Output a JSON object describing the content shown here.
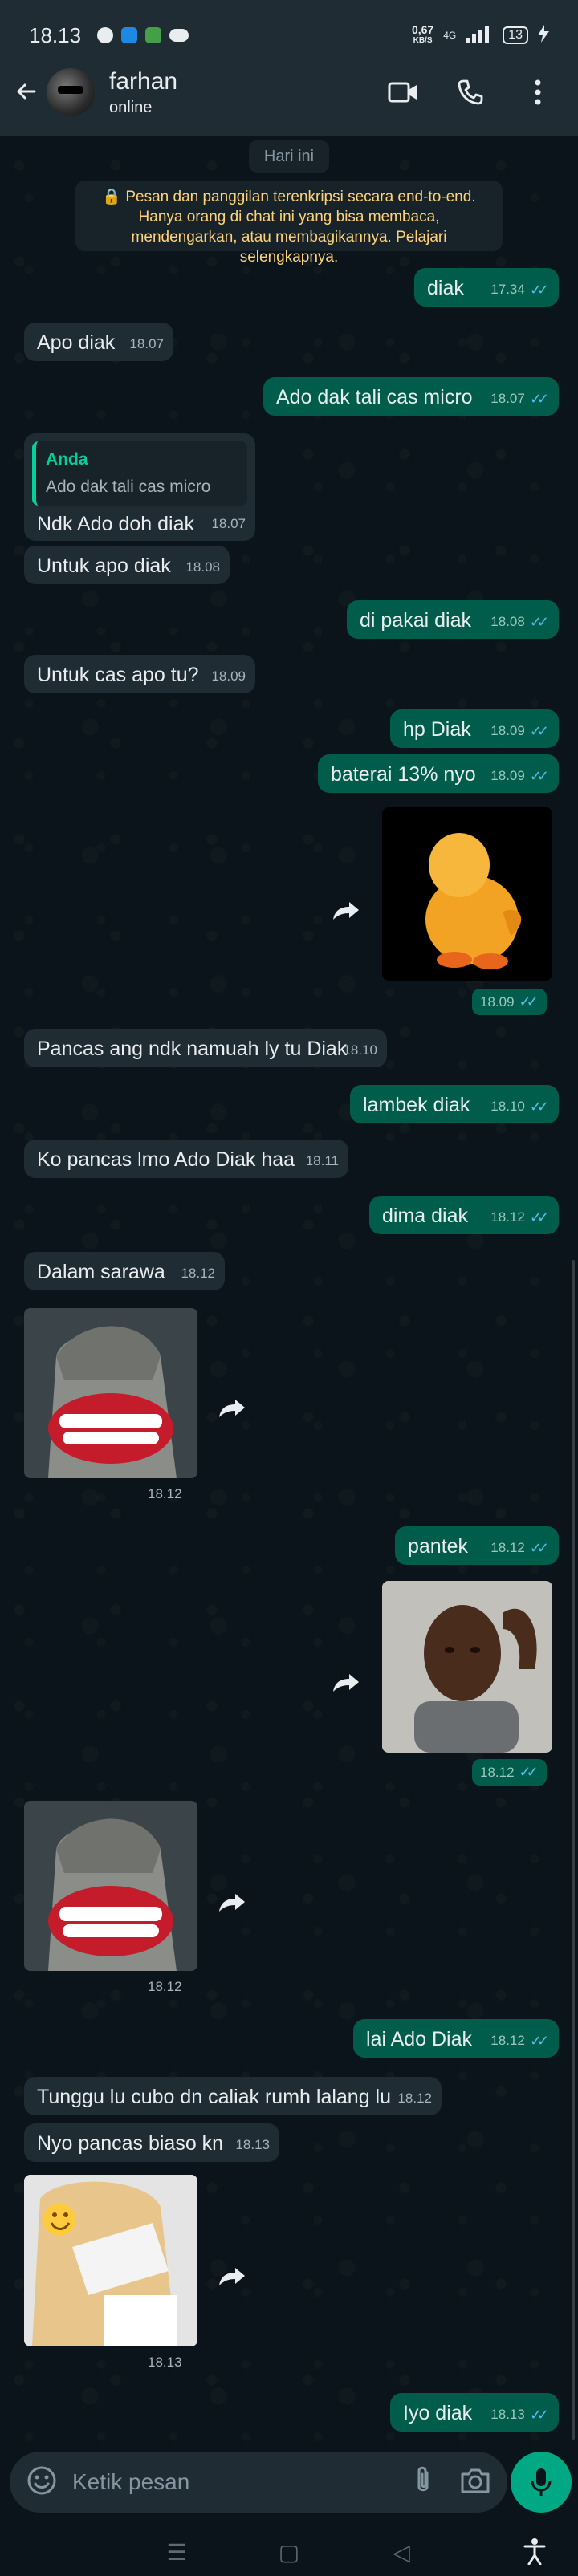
{
  "status_bar": {
    "time": "18.13",
    "net_speed_value": "0,67",
    "net_speed_unit": "KB/S",
    "network": "4G",
    "battery": "13"
  },
  "header": {
    "contact_name": "farhan",
    "contact_status": "online"
  },
  "chat": {
    "date_chip": "Hari ini",
    "e2e_notice": "Pesan dan panggilan terenkripsi secara end-to-end. Hanya orang di chat ini yang bisa membaca, mendengarkan, atau membagikannya. Pelajari selengkapnya.",
    "messages": [
      {
        "text": "diak",
        "time": "17.34"
      },
      {
        "text": "Apo diak",
        "time": "18.07"
      },
      {
        "text": "Ado dak tali cas micro",
        "time": "18.07"
      },
      {
        "quote_author": "Anda",
        "quote_text": "Ado dak tali cas micro",
        "text": "Ndk Ado doh diak",
        "time": "18.07"
      },
      {
        "text": "Untuk apo diak",
        "time": "18.08"
      },
      {
        "text": "di pakai diak",
        "time": "18.08"
      },
      {
        "text": "Untuk cas apo tu?",
        "time": "18.09"
      },
      {
        "text": "hp Diak",
        "time": "18.09"
      },
      {
        "text": "baterai 13% nyo",
        "time": "18.09"
      },
      {
        "media": "duck-sticker",
        "time": "18.09"
      },
      {
        "text": "Pancas ang ndk namuah ly tu Diak",
        "time": "18.10"
      },
      {
        "text": "lambek diak",
        "time": "18.10"
      },
      {
        "text": "Ko pancas lmo Ado Diak haa",
        "time": "18.11"
      },
      {
        "text": "dima diak",
        "time": "18.12"
      },
      {
        "text": "Dalam sarawa",
        "time": "18.12"
      },
      {
        "media": "moai-smile-sticker",
        "time": "18.12"
      },
      {
        "text": "pantek",
        "time": "18.12"
      },
      {
        "media": "man-photo",
        "time": "18.12"
      },
      {
        "media": "moai-smile-sticker",
        "time": "18.12"
      },
      {
        "text": "lai Ado Diak",
        "time": "18.12"
      },
      {
        "text": "Tunggu lu cubo dn caliak rumh lalang lu",
        "time": "18.12"
      },
      {
        "text": "Nyo pancas biaso kn",
        "time": "18.13"
      },
      {
        "media": "anime-girl-sticker",
        "time": "18.13"
      },
      {
        "text": "Iyo diak",
        "time": "18.13"
      }
    ]
  },
  "composer": {
    "placeholder": "Ketik pesan"
  },
  "colors": {
    "background": "#0b141a",
    "incoming_bubble": "#1f2c34",
    "outgoing_bubble": "#005c4b",
    "read_ticks": "#53bdeb",
    "notice_text": "#ffd279",
    "accent": "#00a884"
  }
}
